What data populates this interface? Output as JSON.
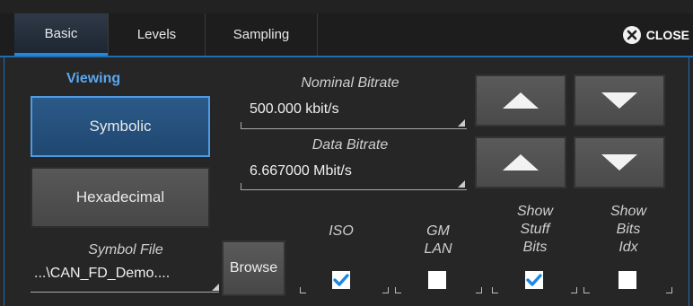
{
  "tabs": [
    {
      "label": "Basic",
      "active": true
    },
    {
      "label": "Levels",
      "active": false
    },
    {
      "label": "Sampling",
      "active": false
    }
  ],
  "close_label": "CLOSE",
  "viewing": {
    "heading": "Viewing",
    "symbolic_label": "Symbolic",
    "hexadecimal_label": "Hexadecimal",
    "selected": "Symbolic"
  },
  "symbol_file": {
    "label": "Symbol File",
    "value": "...\\CAN_FD_Demo....",
    "browse_label": "Browse"
  },
  "nominal_bitrate": {
    "label": "Nominal Bitrate",
    "value": "500.000 kbit/s"
  },
  "data_bitrate": {
    "label": "Data Bitrate",
    "value": "6.667000 Mbit/s"
  },
  "checkboxes": [
    {
      "label_lines": [
        "ISO"
      ],
      "checked": true
    },
    {
      "label_lines": [
        "GM",
        "LAN"
      ],
      "checked": false
    },
    {
      "label_lines": [
        "Show",
        "Stuff",
        "Bits"
      ],
      "checked": true
    },
    {
      "label_lines": [
        "Show",
        "Bits",
        "Idx"
      ],
      "checked": false
    }
  ],
  "colors": {
    "accent": "#1f6cb0",
    "check": "#1e88e5"
  }
}
